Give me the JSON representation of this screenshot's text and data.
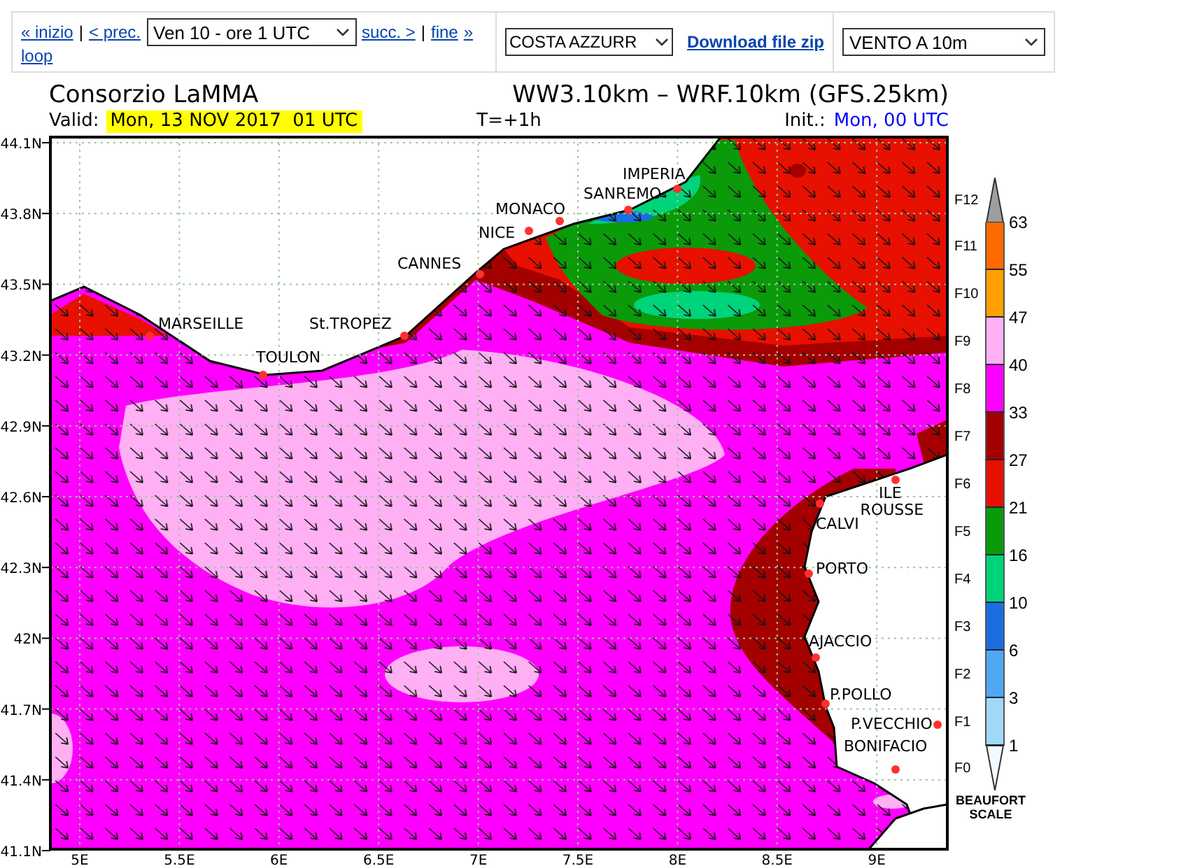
{
  "toolbar": {
    "nav": [
      {
        "kind": "link",
        "text": "« inizio"
      },
      {
        "kind": "separator",
        "text": "|"
      },
      {
        "kind": "link",
        "text": "< prec."
      },
      {
        "kind": "select",
        "text": "Ven 10 - ore 1 UTC"
      },
      {
        "kind": "link",
        "text": "succ. >"
      },
      {
        "kind": "separator",
        "text": "|"
      },
      {
        "kind": "link",
        "text": "fine"
      },
      {
        "kind": "link",
        "text": "»"
      },
      {
        "kind": "link",
        "text": "loop"
      }
    ],
    "region_select": "COSTA AZZURR",
    "download_link": "Download file zip",
    "field_select": "VENTO A 10m"
  },
  "header": {
    "title": "Consorzio LaMMA",
    "models": "WW3.10km – WRF.10km (GFS.25km)",
    "valid_label": "Valid:",
    "valid_time": "Mon, 13 NOV 2017  01 UTC",
    "lead_time": "T=+1h",
    "init_label": "Init.:",
    "init_time": "Mon, 00 UTC"
  },
  "map": {
    "latitudes": [
      "44.1N",
      "43.8N",
      "43.5N",
      "43.2N",
      "42.9N",
      "42.6N",
      "42.3N",
      "42N",
      "41.7N",
      "41.4N",
      "41.1N"
    ],
    "longitudes": [
      "5E",
      "5.5E",
      "6E",
      "6.5E",
      "7E",
      "7.5E",
      "8E",
      "8.5E",
      "9E"
    ],
    "cities": [
      {
        "lines": [
          "IMPERIA"
        ]
      },
      {
        "lines": [
          "SANREMO"
        ]
      },
      {
        "lines": [
          "MONACO"
        ]
      },
      {
        "lines": [
          "NICE"
        ]
      },
      {
        "lines": [
          "CANNES"
        ]
      },
      {
        "lines": [
          "MARSEILLE"
        ]
      },
      {
        "lines": [
          "St.TROPEZ"
        ]
      },
      {
        "lines": [
          "TOULON"
        ]
      },
      {
        "lines": [
          "ILE",
          "ROUSSE"
        ]
      },
      {
        "lines": [
          "CALVI"
        ]
      },
      {
        "lines": [
          "PORTO"
        ]
      },
      {
        "lines": [
          "AJACCIO"
        ]
      },
      {
        "lines": [
          "P.POLLO"
        ]
      },
      {
        "lines": [
          "P.VECCHIO"
        ]
      },
      {
        "lines": [
          "BONIFACIO"
        ]
      }
    ]
  },
  "legend": {
    "bands": [
      {
        "kind": "arrow",
        "force": "F12",
        "color": "#9e9e9e"
      },
      {
        "kind": "band",
        "force": "F11",
        "value": "63",
        "color": "#ff6a00"
      },
      {
        "kind": "band",
        "force": "F10",
        "value": "55",
        "color": "#ff9f00"
      },
      {
        "kind": "band",
        "force": "F9",
        "value": "47",
        "color": "#ffb0f5"
      },
      {
        "kind": "band",
        "force": "F8",
        "value": "40",
        "color": "#ff00ff"
      },
      {
        "kind": "band",
        "force": "F7",
        "value": "33",
        "color": "#a50000"
      },
      {
        "kind": "band",
        "force": "F6",
        "value": "27",
        "color": "#e81000"
      },
      {
        "kind": "band",
        "force": "F5",
        "value": "21",
        "color": "#0a9a0a"
      },
      {
        "kind": "band",
        "force": "F4",
        "value": "16",
        "color": "#00d47a"
      },
      {
        "kind": "band",
        "force": "F3",
        "value": "10",
        "color": "#1a6ee0"
      },
      {
        "kind": "band",
        "force": "F2",
        "value": "6",
        "color": "#50a8f5"
      },
      {
        "kind": "band",
        "force": "F1",
        "value": "3",
        "color": "#a0d8f8"
      },
      {
        "kind": "arrow",
        "force": "F0",
        "value": "1",
        "color": "#f4fbff"
      }
    ],
    "caption": "BEAUFORT SCALE"
  }
}
